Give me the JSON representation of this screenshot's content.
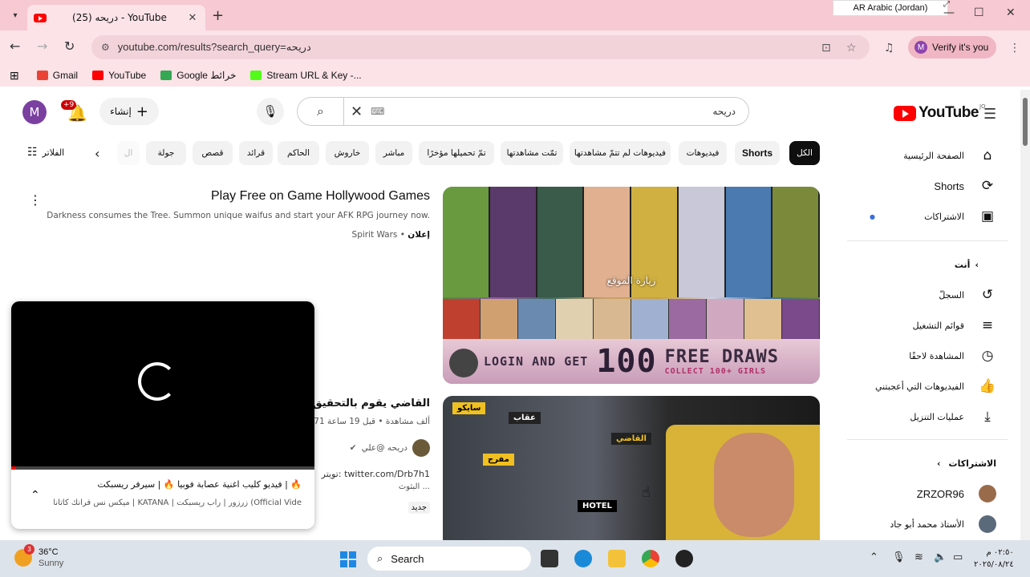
{
  "browser": {
    "tab_title": "(25) دريحه - YouTube",
    "tab_close": "✕",
    "new_tab": "+",
    "lang_indicator": "AR Arabic (Jordan)",
    "url": "youtube.com/results?search_query=دريحه",
    "verify_label": "Verify it's you",
    "verify_avatar": "M",
    "bookmarks": [
      {
        "label": "Gmail",
        "color": "#ea4335"
      },
      {
        "label": "YouTube",
        "color": "#ff0000"
      },
      {
        "label": "Google خرائط",
        "color": "#34a853"
      },
      {
        "label": "Stream URL & Key -...",
        "color": "#53fc18"
      }
    ]
  },
  "youtube": {
    "avatar": "M",
    "bell_badge": "+9",
    "create_label": "إنشاء",
    "search_query": "دريحه",
    "logo_word": "YouTube",
    "logo_country": "JO",
    "filters_label": "الفلاتر",
    "chips": [
      "الكل",
      "Shorts",
      "فيديوهات",
      "فيديوهات لم تتمّ مشاهدتها",
      "تمّت مشاهدتها",
      "تمّ تحميلها مؤخرًا",
      "مباشر",
      "خاروش",
      "الحاكم",
      "قرائد",
      "قصص",
      "جولة",
      "ال"
    ],
    "sidebar": {
      "items": [
        {
          "label": "الصفحة الرئيسية",
          "icon": "home-icon",
          "glyph": "⌂"
        },
        {
          "label": "Shorts",
          "icon": "shorts-icon",
          "glyph": "⟳"
        },
        {
          "label": "الاشتراكات",
          "icon": "subscriptions-icon",
          "glyph": "▣"
        }
      ],
      "you_label": "أنت",
      "you_items": [
        {
          "label": "السجلّ",
          "icon": "history-icon",
          "glyph": "↺"
        },
        {
          "label": "قوائم التشغيل",
          "icon": "playlists-icon",
          "glyph": "≡"
        },
        {
          "label": "المشاهدة لاحقًا",
          "icon": "watch-later-icon",
          "glyph": "◷"
        },
        {
          "label": "الفيديوهات التي أعجبتني",
          "icon": "liked-icon",
          "glyph": "👍"
        },
        {
          "label": "عمليات التنزيل",
          "icon": "download-icon",
          "glyph": "⤓"
        }
      ],
      "subs_label": "الاشتراكات",
      "subs": [
        {
          "label": "ZRZOR96"
        },
        {
          "label": "الأستاذ محمد أبو جاد"
        }
      ]
    },
    "ad": {
      "title": "Play Free on Game Hollywood Games",
      "description": "Darkness consumes the Tree. Summon unique waifus and start your AFK RPG journey now.",
      "sponsor": "Spirit Wars",
      "sponsored": "إعلان",
      "visit": "زيارة الموقع",
      "banner_left": "LOGIN AND GET",
      "banner_num": "100",
      "banner_right": "FREE DRAWS",
      "banner_sub": "COLLECT 100+ GIRLS"
    },
    "video2": {
      "title": "القاضي يقوم بالتحقيق مع مفـ",
      "meta": "271 ألف مشاهدة • قبل 19 ساعة",
      "channel": "دريحه @علي",
      "desc": "تويتر: twitter.com/Drb7h1",
      "desc2": "البثوث ...",
      "new_badge": "جديد",
      "tags": [
        "سايكو",
        "عقاب",
        "القاضي",
        "مفرج",
        "HOTEL"
      ]
    },
    "mini_player": {
      "title": "فيديو كليب اغنية عصابة فوبيا 🔥 | سيرفر ريسبكت | 🔥",
      "subtitle": "ميكس نس فرانك كاتانا | KATANA | زرزور | راب ريسبكت (Official Vide"
    }
  },
  "taskbar": {
    "temp": "36°C",
    "weather": "Sunny",
    "weather_badge": "3",
    "search": "Search",
    "time": "٠٢:٥٠ م",
    "date": "٢٠٢٥/٠٨/٢٤"
  }
}
